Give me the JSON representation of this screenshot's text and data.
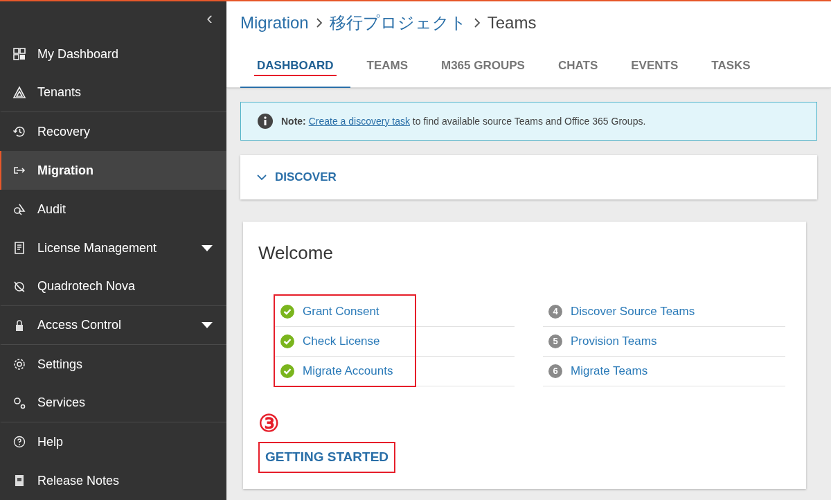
{
  "sidebar": {
    "collapse": "‹",
    "items": [
      {
        "label": "My Dashboard",
        "selected": false,
        "expandable": false,
        "divider": false
      },
      {
        "label": "Tenants",
        "selected": false,
        "expandable": false,
        "divider": true
      },
      {
        "label": "Recovery",
        "selected": false,
        "expandable": false,
        "divider": false
      },
      {
        "label": "Migration",
        "selected": true,
        "expandable": false,
        "divider": false
      },
      {
        "label": "Audit",
        "selected": false,
        "expandable": false,
        "divider": false
      },
      {
        "label": "License Management",
        "selected": false,
        "expandable": true,
        "divider": false
      },
      {
        "label": "Quadrotech Nova",
        "selected": false,
        "expandable": false,
        "divider": true
      },
      {
        "label": "Access Control",
        "selected": false,
        "expandable": true,
        "divider": true
      },
      {
        "label": "Settings",
        "selected": false,
        "expandable": false,
        "divider": false
      },
      {
        "label": "Services",
        "selected": false,
        "expandable": false,
        "divider": true
      },
      {
        "label": "Help",
        "selected": false,
        "expandable": false,
        "divider": false
      },
      {
        "label": "Release Notes",
        "selected": false,
        "expandable": false,
        "divider": false
      }
    ]
  },
  "breadcrumb": [
    {
      "label": "Migration",
      "link": true
    },
    {
      "label": "移行プロジェクト",
      "link": true
    },
    {
      "label": "Teams",
      "link": false
    }
  ],
  "tabs": [
    {
      "label": "DASHBOARD",
      "selected": true,
      "annotated": true
    },
    {
      "label": "TEAMS",
      "selected": false,
      "annotated": false
    },
    {
      "label": "M365 GROUPS",
      "selected": false,
      "annotated": false
    },
    {
      "label": "CHATS",
      "selected": false,
      "annotated": false
    },
    {
      "label": "EVENTS",
      "selected": false,
      "annotated": false
    },
    {
      "label": "TASKS",
      "selected": false,
      "annotated": false
    }
  ],
  "note": {
    "label": "Note:",
    "link": "Create a discovery task",
    "text": "to find available source Teams and Office 365 Groups."
  },
  "discover": {
    "label": "DISCOVER",
    "expanded": false
  },
  "welcome": {
    "title": "Welcome",
    "steps": [
      {
        "label": "Grant Consent",
        "done": true
      },
      {
        "label": "Check License",
        "done": true
      },
      {
        "label": "Migrate Accounts",
        "done": true
      },
      {
        "label": "Discover Source Teams",
        "done": false,
        "number": "4"
      },
      {
        "label": "Provision Teams",
        "done": false,
        "number": "5"
      },
      {
        "label": "Migrate Teams",
        "done": false,
        "number": "6"
      }
    ],
    "annotation_mark": "③",
    "getting_started": "GETTING STARTED"
  }
}
